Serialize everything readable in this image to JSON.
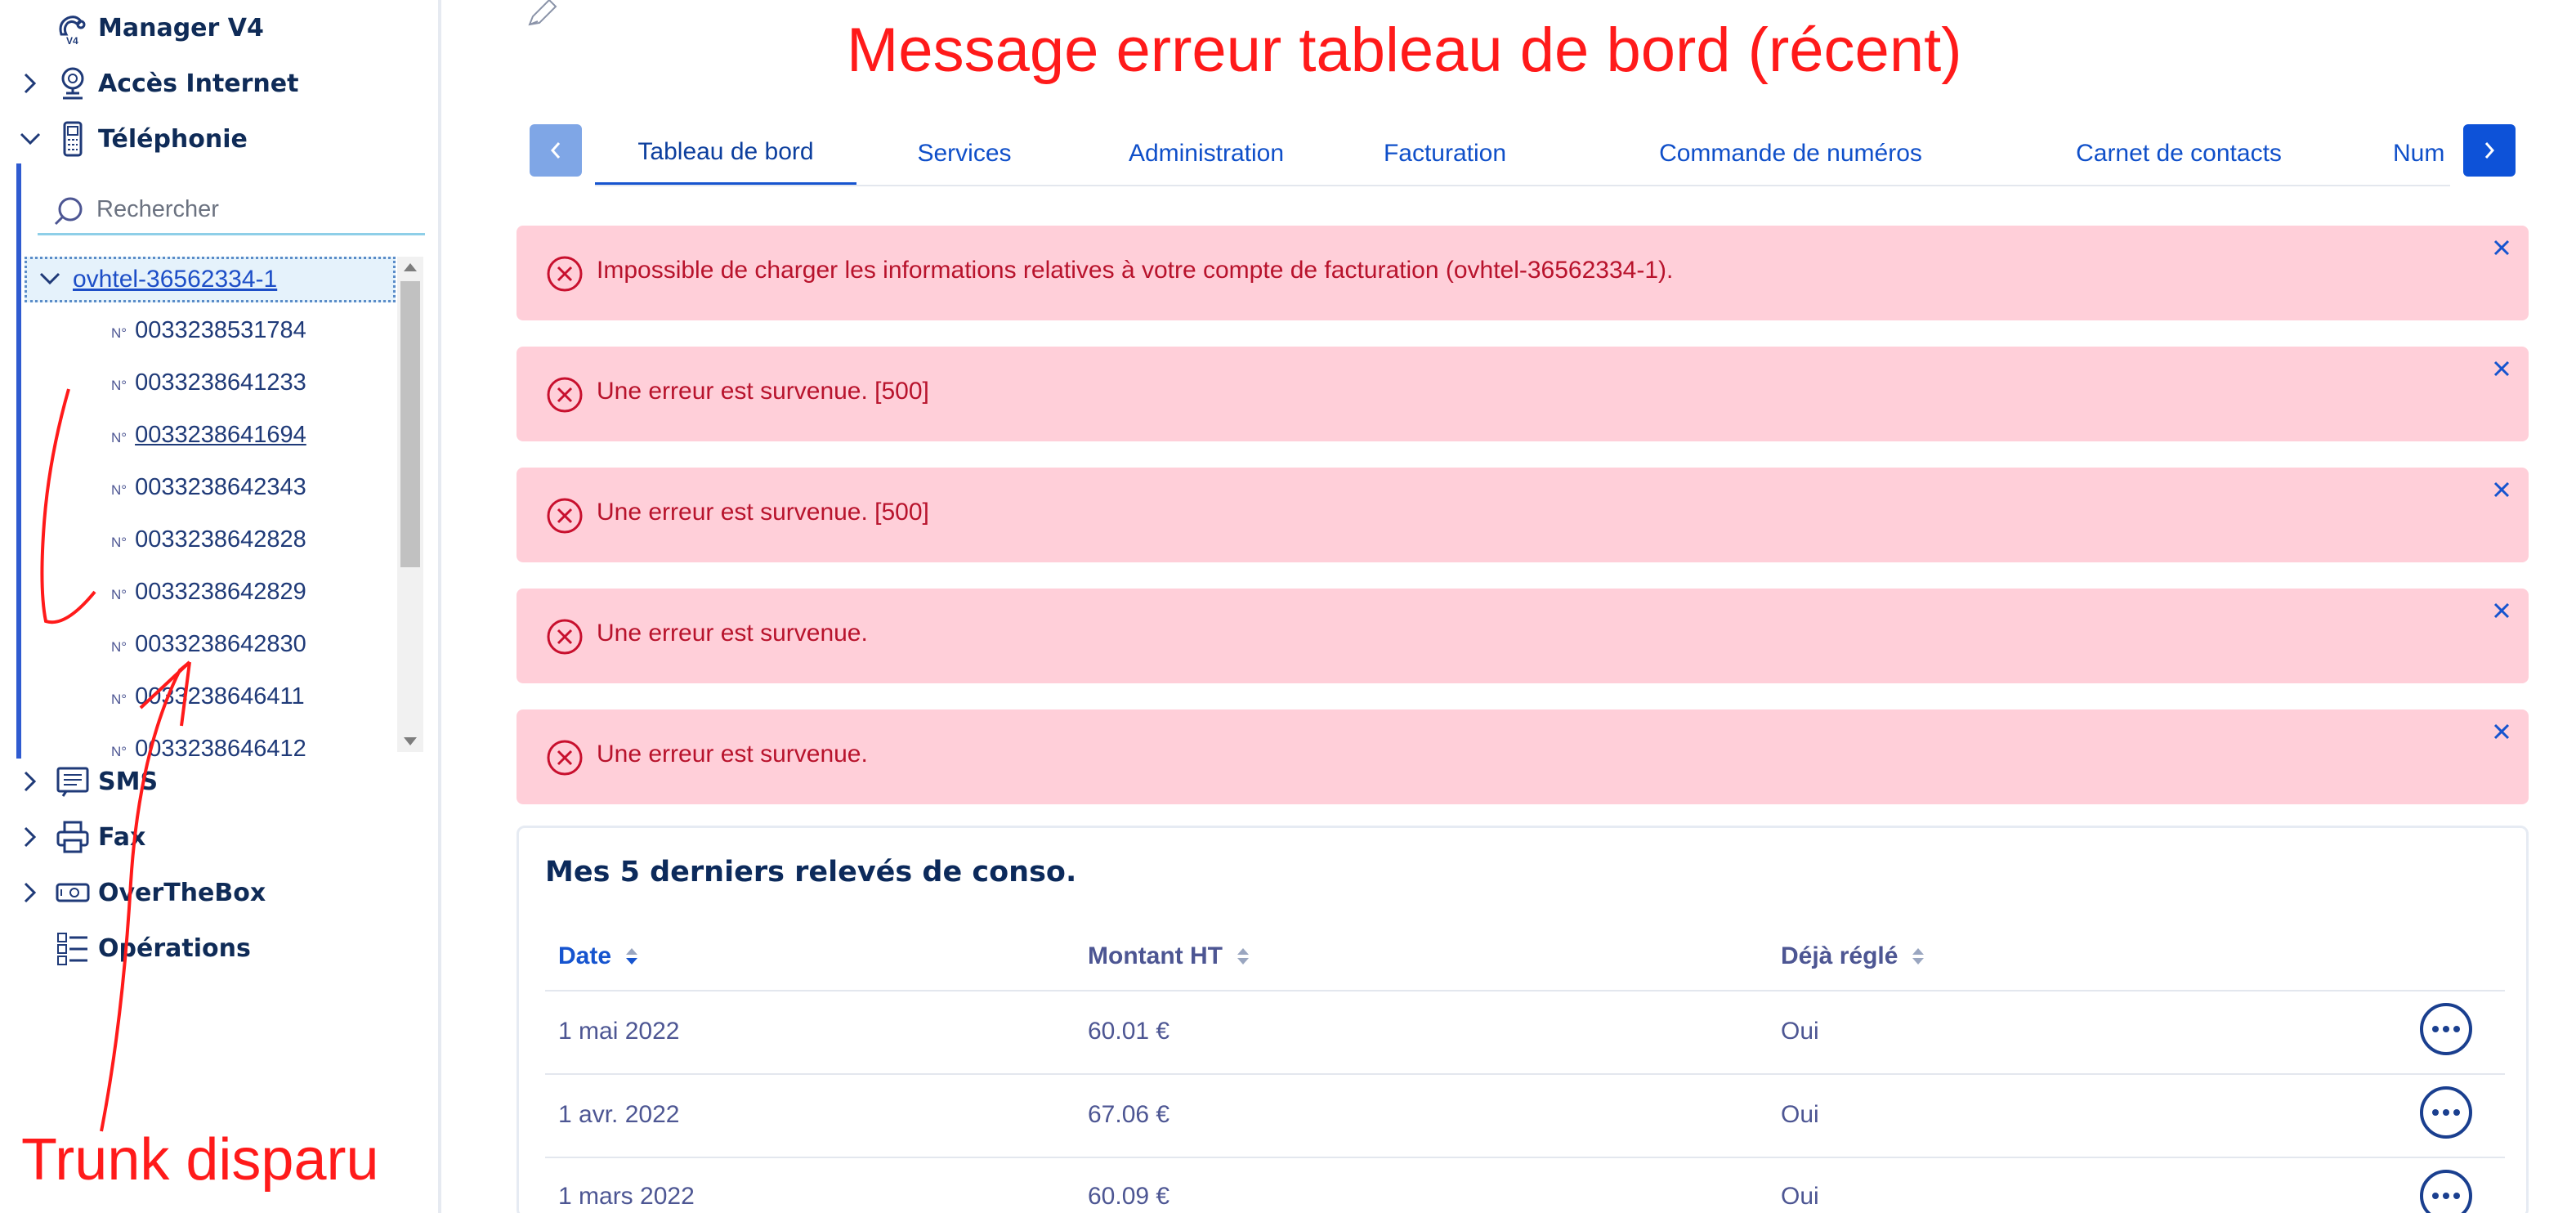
{
  "sidebar": {
    "items": [
      {
        "label": "Manager V4",
        "icon": "v4-logo-icon",
        "expandable": false
      },
      {
        "label": "Accès Internet",
        "icon": "internet-access-icon",
        "expandable": true,
        "expanded": false
      },
      {
        "label": "Téléphonie",
        "icon": "phone-icon",
        "expandable": true,
        "expanded": true
      },
      {
        "label": "SMS",
        "icon": "sms-icon",
        "expandable": true,
        "expanded": false
      },
      {
        "label": "Fax",
        "icon": "fax-icon",
        "expandable": true,
        "expanded": false
      },
      {
        "label": "OverTheBox",
        "icon": "overthebox-icon",
        "expandable": true,
        "expanded": false
      },
      {
        "label": "Opérations",
        "icon": "operations-icon",
        "expandable": false
      }
    ],
    "search_placeholder": "Rechercher",
    "tree": {
      "root": "ovhtel-36562334-1",
      "number_prefix": "N°",
      "numbers": [
        "0033238531784",
        "0033238641233",
        "0033238641694",
        "0033238642343",
        "0033238642828",
        "0033238642829",
        "0033238642830",
        "0033238646411",
        "0033238646412"
      ]
    }
  },
  "annotations": {
    "title": "Message erreur tableau de bord (récent)",
    "trunk": "Trunk disparu",
    "color": "#ff1a1a"
  },
  "tabs": [
    "Tableau de bord",
    "Services",
    "Administration",
    "Facturation",
    "Commande de numéros",
    "Carnet de contacts",
    "Num"
  ],
  "active_tab": "Tableau de bord",
  "alerts": [
    "Impossible de charger les informations relatives à votre compte de facturation (ovhtel-36562334-1).",
    "Une erreur est survenue. [500]",
    "Une erreur est survenue. [500]",
    "Une erreur est survenue.",
    "Une erreur est survenue."
  ],
  "conso": {
    "title": "Mes 5 derniers relevés de conso.",
    "columns": [
      "Date",
      "Montant HT",
      "Déjà réglé"
    ],
    "rows": [
      {
        "date": "1 mai 2022",
        "amount": "60.01 €",
        "paid": "Oui"
      },
      {
        "date": "1 avr. 2022",
        "amount": "67.06 €",
        "paid": "Oui"
      },
      {
        "date": "1 mars 2022",
        "amount": "60.09 €",
        "paid": "Oui"
      }
    ]
  },
  "colors": {
    "brand": "#0050d7",
    "alert_bg": "#ffcfd9",
    "alert_text": "#b8132c",
    "nav_text": "#0f2b57"
  }
}
